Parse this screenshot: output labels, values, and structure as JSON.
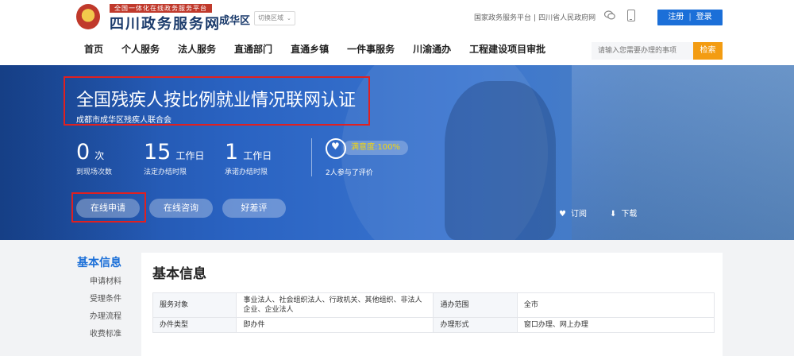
{
  "header": {
    "slogan": "全国一体化在线政务服务平台",
    "logo": "四川政务服务网",
    "district": "成华区",
    "switch_area": "切换区域",
    "top_links": [
      "国家政务服务平台",
      "四川省人民政府网"
    ],
    "register": "注册",
    "login": "登录"
  },
  "nav": {
    "items": [
      "首页",
      "个人服务",
      "法人服务",
      "直通部门",
      "直通乡镇",
      "一件事服务",
      "川渝通办",
      "工程建设项目审批"
    ]
  },
  "search": {
    "placeholder": "请输入您需要办理的事项",
    "button": "检索"
  },
  "banner": {
    "title": "全国残疾人按比例就业情况联网认证",
    "department": "成都市成华区残疾人联合会",
    "stats": [
      {
        "num": "0",
        "unit": "次",
        "label": "到现场次数"
      },
      {
        "num": "15",
        "unit": "工作日",
        "label": "法定办结时限"
      },
      {
        "num": "1",
        "unit": "工作日",
        "label": "承诺办结时限"
      }
    ],
    "satisfaction": "满意度:100%",
    "eval_count": "2人参与了评价",
    "buttons": [
      "在线申请",
      "在线咨询",
      "好差评"
    ],
    "subscribe": "订阅",
    "download": "下载"
  },
  "sidebar": {
    "title": "基本信息",
    "items": [
      "申请材料",
      "受理条件",
      "办理流程",
      "收费标准"
    ]
  },
  "basic_info": {
    "title": "基本信息",
    "rows": [
      {
        "k1": "服务对象",
        "v1": "事业法人、社会组织法人、行政机关、其他组织、非法人企业、企业法人",
        "k2": "通办范围",
        "v2": "全市"
      },
      {
        "k1": "办件类型",
        "v1": "即办件",
        "k2": "办理形式",
        "v2": "窗口办理、网上办理"
      }
    ]
  },
  "colors": {
    "brand_blue": "#1b6fd8",
    "search_orange": "#f39c12",
    "highlight_red": "#e02020",
    "satisfaction_yellow": "#f5d60a"
  }
}
